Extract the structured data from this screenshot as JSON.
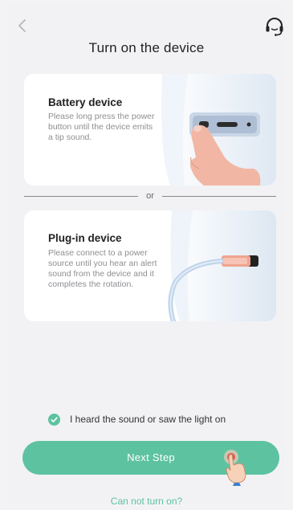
{
  "header": {
    "title": "Turn on the device",
    "back_icon": "chevron-left-icon",
    "support_icon": "headset-icon"
  },
  "options": [
    {
      "title": "Battery device",
      "description": "Please long press the power button until the device emits a tip sound."
    },
    {
      "title": "Plug-in device",
      "description": "Please connect to a power source until you hear an alert sound from the device and it completes the rotation."
    }
  ],
  "divider_label": "or",
  "confirmation": {
    "label": "I heard the sound or saw the light on",
    "checked": true
  },
  "primary_button": {
    "label": "Next Step"
  },
  "help_link": "Can not turn on?",
  "colors": {
    "accent": "#5dc2a0",
    "background": "#f2f2f4",
    "card": "#ffffff",
    "text_primary": "#222222",
    "text_secondary": "#8f8f94"
  }
}
